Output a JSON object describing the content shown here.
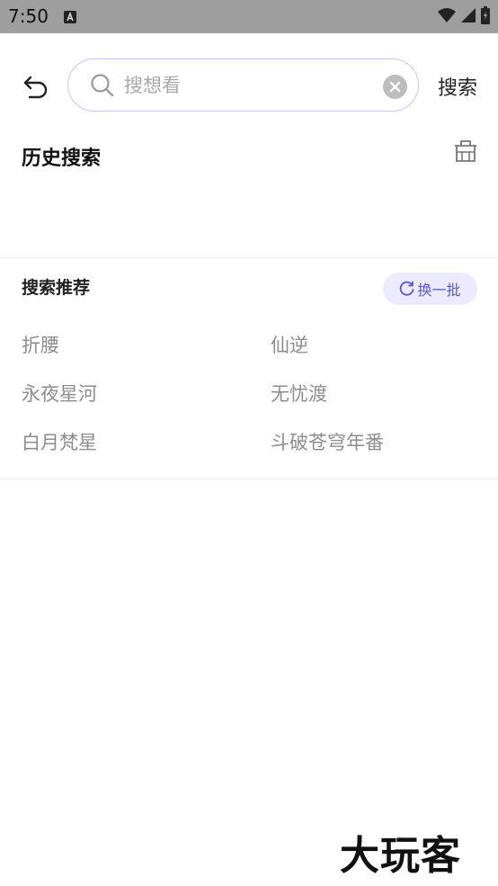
{
  "status_bar": {
    "time": "7:50",
    "icons": [
      "a-notification-icon",
      "wifi-icon",
      "signal-icon",
      "battery-icon"
    ]
  },
  "header": {
    "search_placeholder": "搜想看",
    "search_value": "",
    "submit_label": "搜索"
  },
  "history": {
    "title": "历史搜索",
    "items": []
  },
  "recommend": {
    "title": "搜索推荐",
    "refresh_label": "换一批",
    "items": [
      "折腰",
      "仙逆",
      "永夜星河",
      "无忧渡",
      "白月梵星",
      "斗破苍穹年番"
    ]
  },
  "colors": {
    "accent": "#5a55d6",
    "accent_bg": "#eceaff",
    "search_border": "#c9c7ef",
    "status_bar": "#9e9e9e"
  },
  "watermark": "大玩客"
}
